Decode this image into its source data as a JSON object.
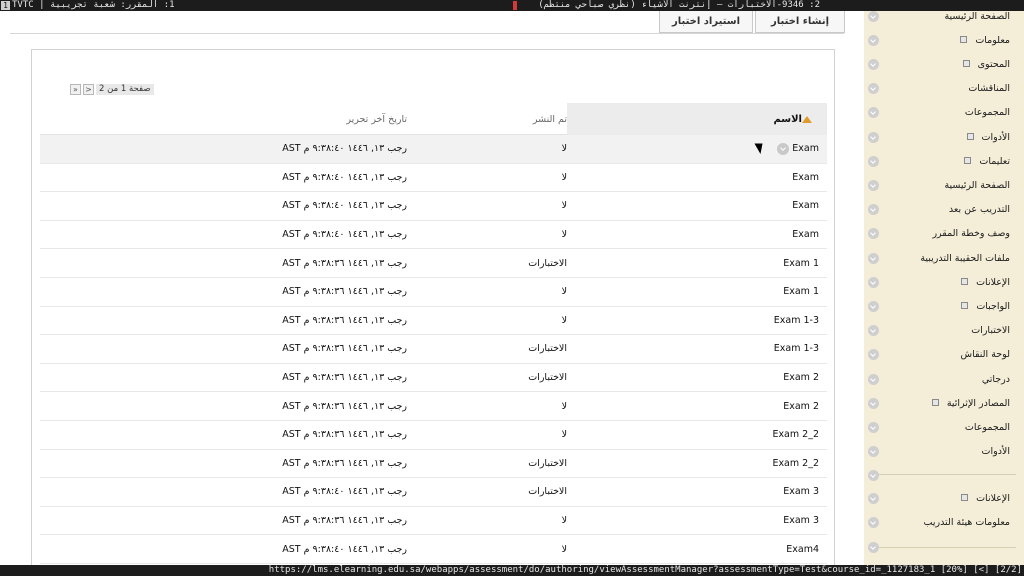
{
  "topbar": {
    "left_badge": "1",
    "left_text": "1: المقرر: شعبة تجريبية | TVTC",
    "right_text": "2: 9346-الاختبارات – إنترنت الأشياء (نظري صباحي منتظم)"
  },
  "statusbar": {
    "url": "https://lms.elearning.edu.sa/webapps/assessment/do/authoring/viewAssessmentManager?assessmentType=Test&course_id=_1127183_1",
    "zoom": "[20%]",
    "nav": "[<]",
    "tabs": "[2/2]"
  },
  "tabs": {
    "create": "إنشاء اختبار",
    "import": "استيراد اختبار"
  },
  "pager": {
    "text": "صفحة 1 من 2",
    "next": ">",
    "last": "»"
  },
  "columns": {
    "name": "الاسم",
    "published": "تم النشر",
    "modified": "تاريخ آخر تحرير"
  },
  "rows": [
    {
      "name": "Exam",
      "published": "لا",
      "modified": "رجب ١٣, ١٤٤٦ ٩:٣٨:٤٠ م AST"
    },
    {
      "name": "Exam",
      "published": "لا",
      "modified": "رجب ١٣, ١٤٤٦ ٩:٣٨:٤٠ م AST"
    },
    {
      "name": "Exam",
      "published": "لا",
      "modified": "رجب ١٣, ١٤٤٦ ٩:٣٨:٤٠ م AST"
    },
    {
      "name": "Exam",
      "published": "لا",
      "modified": "رجب ١٣, ١٤٤٦ ٩:٣٨:٤٠ م AST"
    },
    {
      "name": "Exam 1",
      "published": "الاختبارات",
      "modified": "رجب ١٣, ١٤٤٦ ٩:٣٨:٣٦ م AST"
    },
    {
      "name": "Exam 1",
      "published": "لا",
      "modified": "رجب ١٣, ١٤٤٦ ٩:٣٨:٣٦ م AST"
    },
    {
      "name": "Exam 1-3",
      "published": "لا",
      "modified": "رجب ١٣, ١٤٤٦ ٩:٣٨:٣٦ م AST"
    },
    {
      "name": "Exam 1-3",
      "published": "الاختبارات",
      "modified": "رجب ١٣, ١٤٤٦ ٩:٣٨:٣٦ م AST"
    },
    {
      "name": "Exam 2",
      "published": "الاختبارات",
      "modified": "رجب ١٣, ١٤٤٦ ٩:٣٨:٣٦ م AST"
    },
    {
      "name": "Exam 2",
      "published": "لا",
      "modified": "رجب ١٣, ١٤٤٦ ٩:٣٨:٣٦ م AST"
    },
    {
      "name": "Exam 2_2",
      "published": "لا",
      "modified": "رجب ١٣, ١٤٤٦ ٩:٣٨:٣٦ م AST"
    },
    {
      "name": "Exam 2_2",
      "published": "الاختبارات",
      "modified": "رجب ١٣, ١٤٤٦ ٩:٣٨:٣٦ م AST"
    },
    {
      "name": "Exam 3",
      "published": "الاختبارات",
      "modified": "رجب ١٣, ١٤٤٦ ٩:٣٨:٤٠ م AST"
    },
    {
      "name": "Exam 3",
      "published": "لا",
      "modified": "رجب ١٣, ١٤٤٦ ٩:٣٨:٣٦ م AST"
    },
    {
      "name": "Exam4",
      "published": "لا",
      "modified": "رجب ١٣, ١٤٤٦ ٩:٣٨:٤٠ م AST"
    }
  ],
  "sidebar": {
    "items": [
      {
        "label": "الصفحة الرئيسية",
        "mini": false
      },
      {
        "label": "معلومات",
        "mini": true
      },
      {
        "label": "المحتوى",
        "mini": true
      },
      {
        "label": "المناقشات",
        "mini": false
      },
      {
        "label": "المجموعات",
        "mini": false
      },
      {
        "label": "الأدوات",
        "mini": true
      },
      {
        "label": "تعليمات",
        "mini": true
      },
      {
        "label": "الصفحة الرئيسية",
        "mini": false
      },
      {
        "label": "التدريب عن بعد",
        "mini": false
      },
      {
        "label": "وصف وخطة المقرر",
        "mini": false
      },
      {
        "label": "ملفات الحقيبة التدريبية",
        "mini": false
      },
      {
        "label": "الإعلانات",
        "mini": true
      },
      {
        "label": "الواجبات",
        "mini": true
      },
      {
        "label": "الاختبارات",
        "mini": false
      },
      {
        "label": "لوحة النقاش",
        "mini": false
      },
      {
        "label": "درجاتي",
        "mini": false
      },
      {
        "label": "المصادر الإثرائية",
        "mini": true
      },
      {
        "label": "المجموعات",
        "mini": false
      },
      {
        "label": "الأدوات",
        "mini": false
      }
    ],
    "bottom_items": [
      {
        "label": "الإعلانات",
        "mini": true
      },
      {
        "label": "معلومات هيئة التدريب",
        "mini": false
      }
    ]
  },
  "colors": {
    "sidebar_bg": "#f4eed9",
    "sort_arrow": "#e09b2d",
    "header_bg": "#ececec"
  }
}
